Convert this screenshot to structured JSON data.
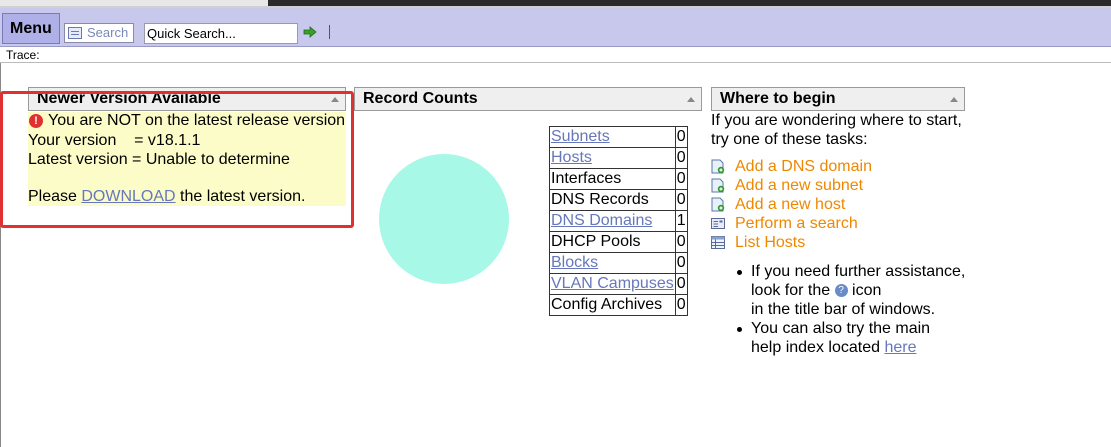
{
  "toolbar": {
    "menu_label": "Menu",
    "search_label": "Search",
    "quick_search_value": "Quick Search..."
  },
  "trace_label": "Trace:",
  "newer_panel": {
    "title": "Newer Version Available",
    "warning_text": "You are NOT on the latest release version",
    "your_version": "Your version    = v18.1.1",
    "latest_version": "Latest version = Unable to determine",
    "download_prefix": "Please ",
    "download_link": "DOWNLOAD",
    "download_suffix": " the latest version."
  },
  "record_counts": {
    "title": "Record Counts",
    "rows": [
      {
        "name": "Subnets",
        "count": "0",
        "link": true
      },
      {
        "name": "Hosts",
        "count": "0",
        "link": true
      },
      {
        "name": "Interfaces",
        "count": "0",
        "link": false
      },
      {
        "name": "DNS Records",
        "count": "0",
        "link": false
      },
      {
        "name": "DNS Domains",
        "count": "1",
        "link": true
      },
      {
        "name": "DHCP Pools",
        "count": "0",
        "link": false
      },
      {
        "name": "Blocks",
        "count": "0",
        "link": true
      },
      {
        "name": "VLAN Campuses",
        "count": "0",
        "link": true
      },
      {
        "name": "Config Archives",
        "count": "0",
        "link": false
      }
    ]
  },
  "where_panel": {
    "title": "Where to begin",
    "intro_line1": "If you are wondering where to start,",
    "intro_line2": "try one of these tasks:",
    "tasks": [
      {
        "label": "Add a DNS domain",
        "icon": "add-doc-icon"
      },
      {
        "label": "Add a new subnet",
        "icon": "add-doc-icon"
      },
      {
        "label": "Add a new host",
        "icon": "add-doc-icon"
      },
      {
        "label": "Perform a search",
        "icon": "search-form-icon"
      },
      {
        "label": "List Hosts",
        "icon": "list-table-icon"
      }
    ],
    "bullet1_line1": "If you need further assistance,",
    "bullet1_line2a": "look for the ",
    "bullet1_line2b": " icon",
    "bullet1_line3": "in the title bar of windows.",
    "bullet2_line1": "You can also try the main",
    "bullet2_line2": "help index located ",
    "bullet2_link": "here"
  },
  "colors": {
    "menubar": "#c8c8ec",
    "notice_bg": "#fcfcc8",
    "task_link": "#ee8800",
    "link": "#6677bb",
    "highlight_box": "#e03030",
    "pie": "#a8f8e8"
  }
}
